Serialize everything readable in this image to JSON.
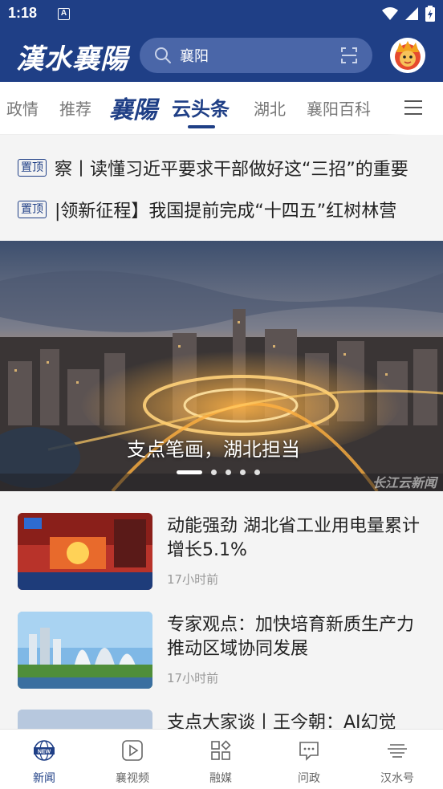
{
  "status_bar": {
    "time": "1:18",
    "notification_glyph": "A"
  },
  "header": {
    "logo_text": "漢水襄陽",
    "search": {
      "value": "襄阳",
      "icon": "search-icon",
      "scan_icon": "scan-icon"
    },
    "avatar_icon": "lion-mascot-avatar"
  },
  "tabs": {
    "items": [
      {
        "label": "政情"
      },
      {
        "label": "推荐"
      },
      {
        "label": "襄陽"
      },
      {
        "label": "云头条"
      },
      {
        "label": "湖北"
      },
      {
        "label": "襄阳百科"
      }
    ],
    "active_index": 3,
    "menu_icon": "hamburger-menu-icon"
  },
  "pinned": [
    {
      "badge": "置顶",
      "text": "察丨读懂习近平要求干部做好这“三招”的重要"
    },
    {
      "badge": "置顶",
      "text": "|领新征程】我国提前完成“十四五”红树林营"
    }
  ],
  "banner": {
    "caption": "支点笔画，湖北担当",
    "watermark": "长江云新闻",
    "slide_count": 5,
    "active_slide": 0
  },
  "news": [
    {
      "title": "动能强劲 湖北省工业用电量累计增长5.1%",
      "time": "17小时前"
    },
    {
      "title": "专家观点：加快培育新质生产力 推动区域协同发展",
      "time": "17小时前"
    },
    {
      "title": "支点大家谈丨王今朝：AI幻觉",
      "time": ""
    }
  ],
  "bottom_nav": [
    {
      "label": "新闻",
      "icon": "news-globe-icon",
      "active": true
    },
    {
      "label": "襄视频",
      "icon": "video-play-icon",
      "active": false
    },
    {
      "label": "融媒",
      "icon": "grid-apps-icon",
      "active": false
    },
    {
      "label": "问政",
      "icon": "chat-bubble-icon",
      "active": false
    },
    {
      "label": "汉水号",
      "icon": "stack-lines-icon",
      "active": false
    }
  ],
  "colors": {
    "brand": "#1f3f86",
    "search_bg": "#4a66a8",
    "list_bg": "#f4f4f4"
  }
}
